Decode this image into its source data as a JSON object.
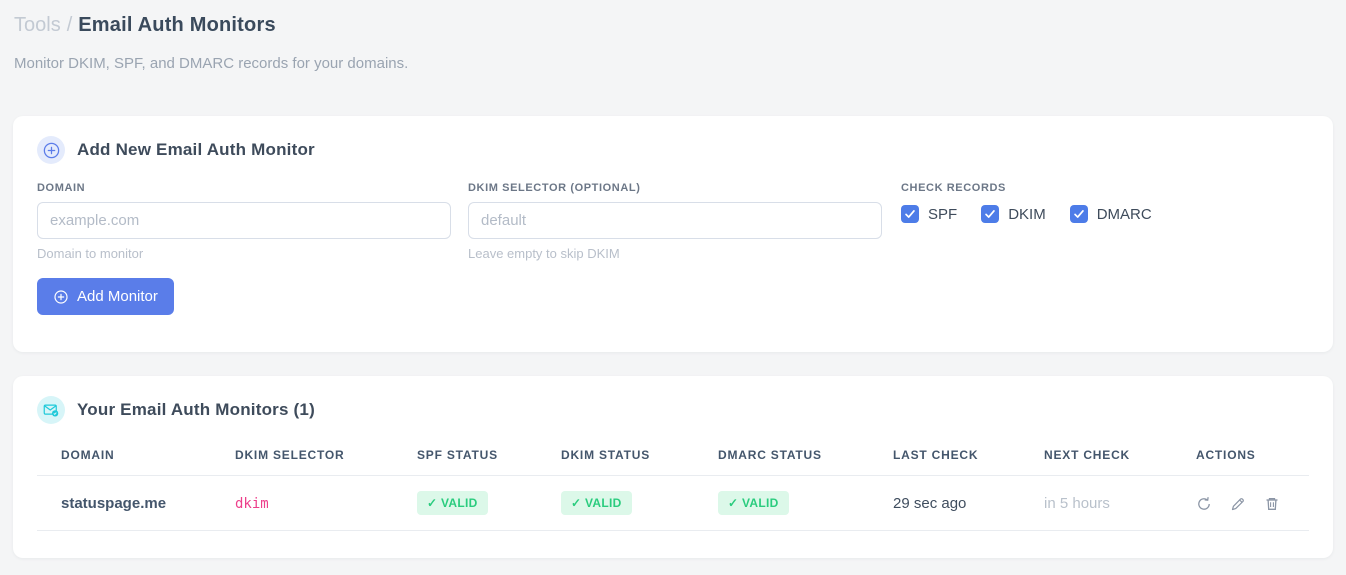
{
  "page": {
    "breadcrumb": {
      "section": "Tools",
      "separator": "/",
      "title": "Email Auth Monitors"
    },
    "subtitle": "Monitor DKIM, SPF, and DMARC records for your domains."
  },
  "add_card": {
    "title": "Add New Email Auth Monitor",
    "icon": "plus-circle-icon",
    "fields": {
      "domain": {
        "label": "DOMAIN",
        "placeholder": "example.com",
        "value": "",
        "help": "Domain to monitor"
      },
      "dkim_selector": {
        "label": "DKIM SELECTOR (OPTIONAL)",
        "placeholder": "default",
        "value": "",
        "help": "Leave empty to skip DKIM"
      }
    },
    "check_records": {
      "label": "CHECK RECORDS",
      "options": [
        {
          "label": "SPF",
          "checked": true
        },
        {
          "label": "DKIM",
          "checked": true
        },
        {
          "label": "DMARC",
          "checked": true
        }
      ]
    },
    "submit_label": "Add Monitor"
  },
  "monitors_card": {
    "title": "Your Email Auth Monitors (1)",
    "icon": "mail-check-icon",
    "table": {
      "columns": [
        "DOMAIN",
        "DKIM SELECTOR",
        "SPF STATUS",
        "DKIM STATUS",
        "DMARC STATUS",
        "LAST CHECK",
        "NEXT CHECK",
        "ACTIONS"
      ],
      "rows": [
        {
          "domain": "statuspage.me",
          "dkim_selector": "dkim",
          "spf_status": "✓ VALID",
          "dkim_status": "✓ VALID",
          "dmarc_status": "✓ VALID",
          "last_check": "29 sec ago",
          "next_check": "in 5 hours",
          "actions": [
            "refresh",
            "edit",
            "delete"
          ]
        }
      ]
    }
  },
  "colors": {
    "accent_blue": "#4d7ce8",
    "button_blue": "#5a7de9",
    "accent_cyan": "#1ec9d9",
    "success_text": "#2acc7e",
    "success_bg": "#dcf8e9",
    "code_pink": "#ed3f8b"
  }
}
